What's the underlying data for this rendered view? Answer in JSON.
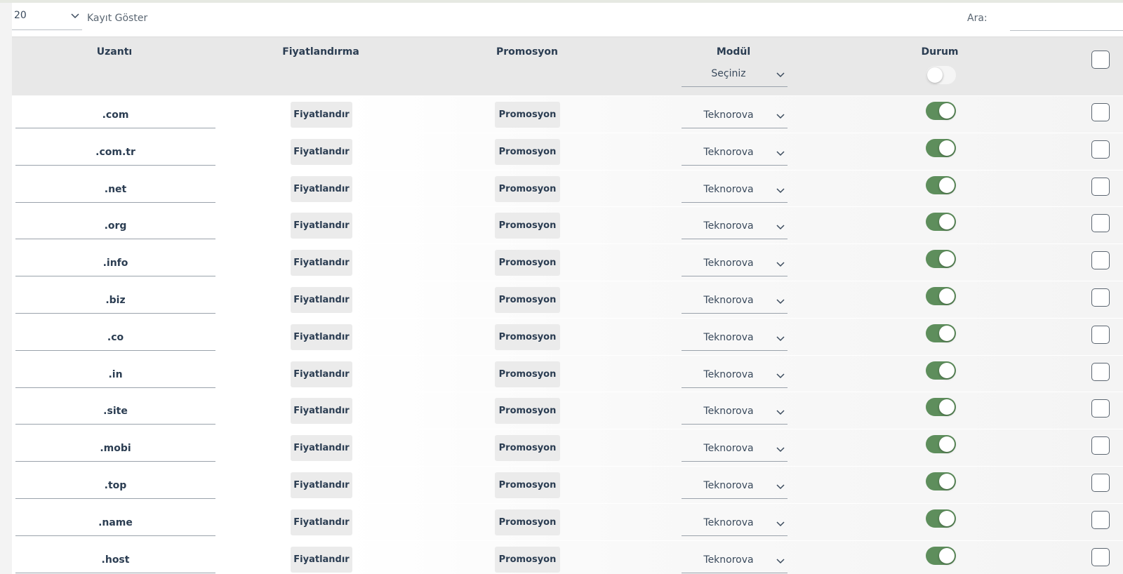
{
  "controls": {
    "page_size": "20",
    "show_label": "Kayıt Göster",
    "search_label": "Ara:",
    "search_value": ""
  },
  "table": {
    "columns": {
      "extension": "Uzantı",
      "pricing": "Fiyatlandırma",
      "promotion": "Promosyon",
      "module": "Modül",
      "status": "Durum"
    },
    "module_filter": "Seçiniz",
    "status_filter_on": false,
    "select_all_checked": false,
    "pricing_button_label": "Fiyatlandır",
    "promotion_button_label": "Promosyon",
    "rows": [
      {
        "extension": ".com",
        "module": "Teknorova",
        "status_on": true,
        "checked": false
      },
      {
        "extension": ".com.tr",
        "module": "Teknorova",
        "status_on": true,
        "checked": false
      },
      {
        "extension": ".net",
        "module": "Teknorova",
        "status_on": true,
        "checked": false
      },
      {
        "extension": ".org",
        "module": "Teknorova",
        "status_on": true,
        "checked": false
      },
      {
        "extension": ".info",
        "module": "Teknorova",
        "status_on": true,
        "checked": false
      },
      {
        "extension": ".biz",
        "module": "Teknorova",
        "status_on": true,
        "checked": false
      },
      {
        "extension": ".co",
        "module": "Teknorova",
        "status_on": true,
        "checked": false
      },
      {
        "extension": ".in",
        "module": "Teknorova",
        "status_on": true,
        "checked": false
      },
      {
        "extension": ".site",
        "module": "Teknorova",
        "status_on": true,
        "checked": false
      },
      {
        "extension": ".mobi",
        "module": "Teknorova",
        "status_on": true,
        "checked": false
      },
      {
        "extension": ".top",
        "module": "Teknorova",
        "status_on": true,
        "checked": false
      },
      {
        "extension": ".name",
        "module": "Teknorova",
        "status_on": true,
        "checked": false
      },
      {
        "extension": ".host",
        "module": "Teknorova",
        "status_on": true,
        "checked": false
      }
    ]
  },
  "colors": {
    "toggle_on": "#5e8e5c",
    "header_bg": "#e8e8e8",
    "button_bg": "#ebebeb",
    "text": "#2b3d52"
  }
}
